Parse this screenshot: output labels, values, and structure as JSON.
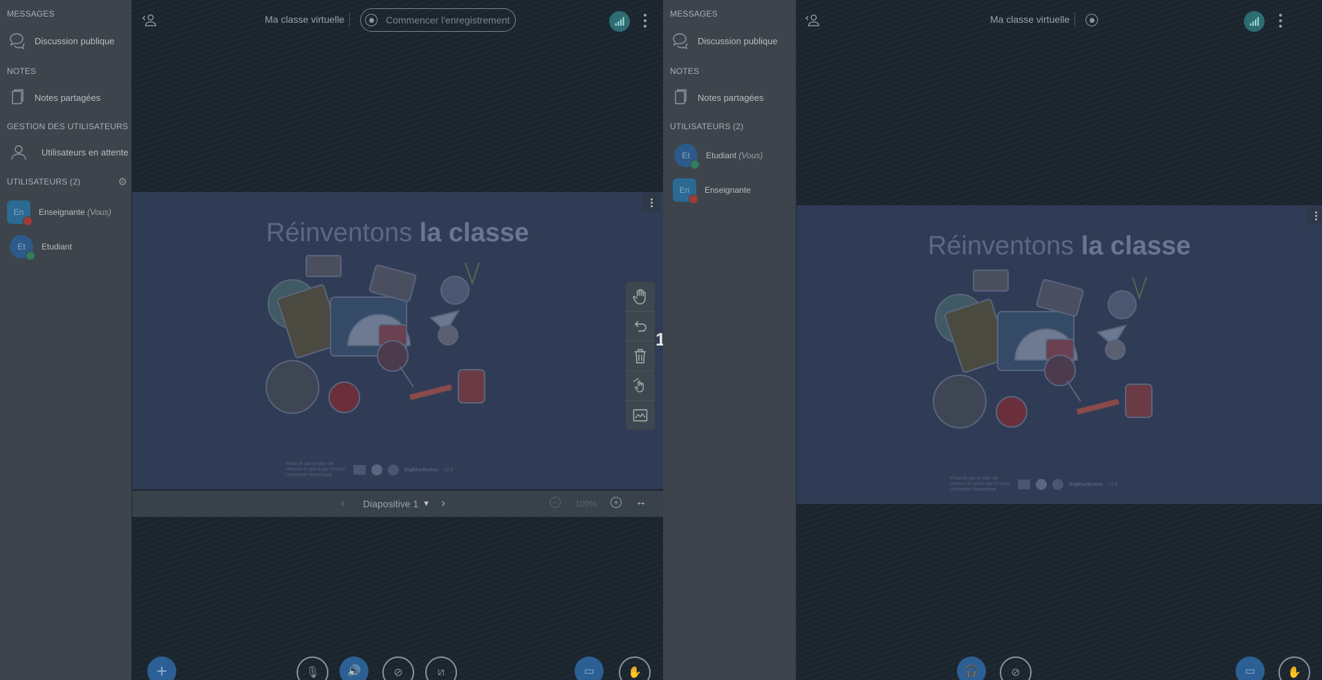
{
  "colors": {
    "sidebar": "#3d444b",
    "main": "#1b252e",
    "slide": "#303c55",
    "accent": "#2c5f94",
    "connection": "#2c6c72"
  },
  "moderator_view": {
    "sections": {
      "messages": "MESSAGES",
      "notes": "NOTES",
      "user_management": "GESTION DES UTILISATEURS",
      "users": "UTILISATEURS (2)"
    },
    "items": {
      "public_chat": "Discussion publique",
      "shared_notes": "Notes partagées",
      "waiting_users": "Utilisateurs en attente"
    },
    "users": [
      {
        "initials": "En",
        "name": "Enseignante",
        "suffix": "(Vous)"
      },
      {
        "initials": "Et",
        "name": "Etudiant",
        "suffix": ""
      }
    ],
    "meeting_title": "Ma classe virtuelle",
    "record_label": "Commencer l'enregistrement",
    "slide_title_light": "Réinventons",
    "slide_title_bold": "la classe",
    "slide_footer": "Financé par le plan de relance et opéré par France Université Numérique",
    "slide_footer_brand": "BigBlueButton",
    "slide_footer_version": "v2.5",
    "cursor_label": "1",
    "slide_selector": "Diapositive 1",
    "zoom": "100%"
  },
  "viewer_view": {
    "sections": {
      "messages": "MESSAGES",
      "notes": "NOTES",
      "users": "UTILISATEURS (2)"
    },
    "items": {
      "public_chat": "Discussion publique",
      "shared_notes": "Notes partagées"
    },
    "users": [
      {
        "initials": "Et",
        "name": "Etudiant",
        "suffix": "(Vous)"
      },
      {
        "initials": "En",
        "name": "Enseignante",
        "suffix": ""
      }
    ],
    "meeting_title": "Ma classe virtuelle",
    "slide_title_light": "Réinventons",
    "slide_title_bold": "la classe",
    "slide_footer": "Financé par le plan de relance et opéré par France Université Numérique",
    "slide_footer_brand": "BigBlueButton",
    "slide_footer_version": "v2.5"
  },
  "icons": [
    "chat-icon",
    "notes-icon",
    "user-icon",
    "gear-icon",
    "connection-icon",
    "more-icon",
    "hand-icon",
    "undo-icon",
    "trash-icon",
    "multi-user-icon",
    "whiteboard-icon",
    "chevron-left-icon",
    "chevron-right-icon",
    "chevron-down-icon",
    "zoom-in-icon",
    "zoom-out-icon",
    "fit-width-icon",
    "plus-icon",
    "mic-off-icon",
    "audio-icon",
    "camera-off-icon",
    "screenshare-off-icon",
    "presentation-icon",
    "raise-hand-icon",
    "headphones-icon"
  ]
}
